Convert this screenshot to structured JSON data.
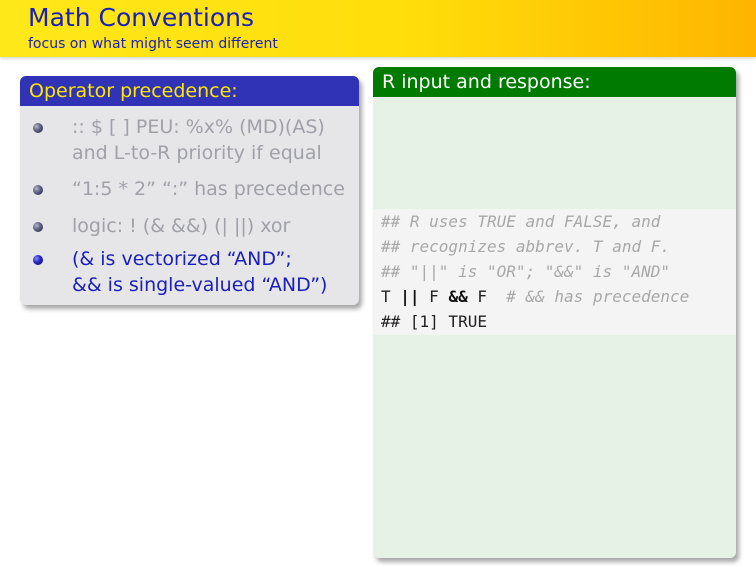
{
  "header": {
    "title": "Math Conventions",
    "subtitle": "focus on what might seem different"
  },
  "left_block": {
    "title": "Operator precedence:",
    "items": [
      {
        "line1": ":: $ [ ] PEU: %x% (MD)(AS)",
        "line2": "and L-to-R priority if equal"
      },
      {
        "line1": "“1:5 * 2” “:” has precedence"
      },
      {
        "line1": "logic: ! (& &&) (| ||) xor"
      },
      {
        "line1": "(& is vectorized “AND”;",
        "line2": "&& is single-valued “AND”)"
      }
    ]
  },
  "right_block": {
    "title": "R input and response:",
    "code": {
      "comment1": "## R uses TRUE and FALSE, and",
      "comment2": "## recognizes abbrev. T and F.",
      "comment3": "## \"||\" is \"OR\"; \"&&\" is \"AND\"",
      "input": {
        "t": "T ",
        "or": "||",
        "f1": " F ",
        "and": "&&",
        "f2": " F ",
        "comment": " # && has precedence"
      },
      "output": "## [1] TRUE"
    }
  },
  "colors": {
    "header_bg": "#ffe81a",
    "title_text": "#1a20b8",
    "left_block_title_bg": "#3033b5",
    "left_block_title_text": "#ffe600",
    "right_block_title_bg": "#007a00",
    "right_block_body_bg": "#e7f2e7",
    "inactive_text": "#a0a0a8"
  }
}
